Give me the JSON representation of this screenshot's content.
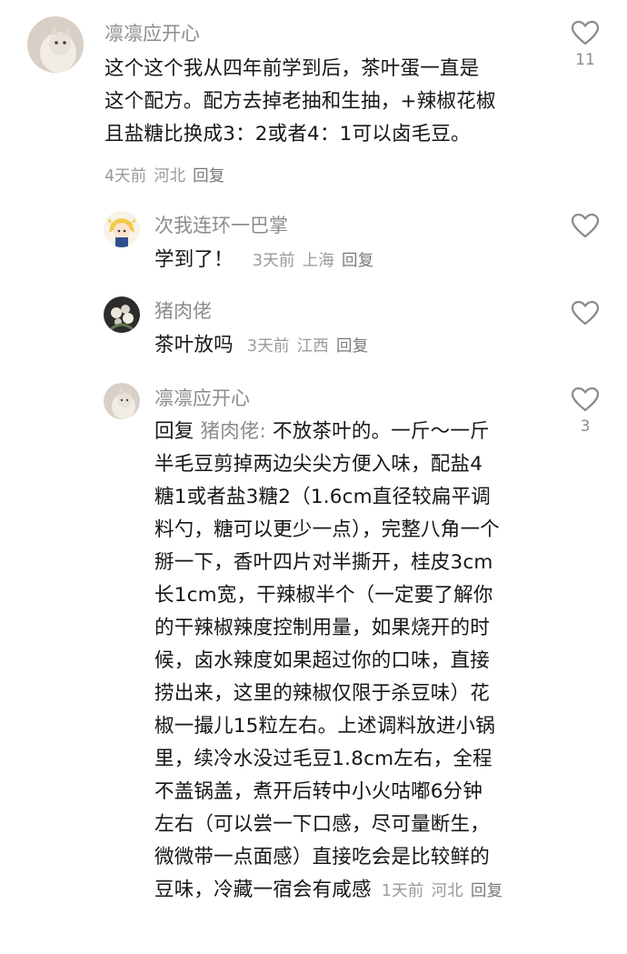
{
  "comments": [
    {
      "username": "凛凛应开心",
      "text_lines": [
        "这个这个我从四年前学到后，茶叶蛋一直是",
        "这个配方。配方去掉老抽和生抽，+辣椒花椒",
        "且盐糖比换成3：2或者4：1可以卤毛豆。"
      ],
      "time": "4天前",
      "location": "河北",
      "reply_label": "回复",
      "like_count": "11",
      "avatar_icon": "cat-photo-avatar"
    },
    {
      "username": "次我连环一巴掌",
      "text": "学到了！",
      "time": "3天前",
      "location": "上海",
      "reply_label": "回复",
      "like_count": "",
      "avatar_icon": "cartoon-girl-avatar"
    },
    {
      "username": "猪肉佬",
      "text": "茶叶放吗",
      "time": "3天前",
      "location": "江西",
      "reply_label": "回复",
      "like_count": "",
      "avatar_icon": "flower-photo-avatar"
    },
    {
      "username": "凛凛应开心",
      "reply_prefix": "回复",
      "reply_target": "猪肉佬:",
      "text_lines": [
        " 不放茶叶的。一斤～一斤",
        "半毛豆剪掉两边尖尖方便入味，配盐4",
        "糖1或者盐3糖2（1.6cm直径较扁平调",
        "料勺，糖可以更少一点），完整八角一个",
        "掰一下，香叶四片对半撕开，桂皮3cm",
        "长1cm宽，干辣椒半个（一定要了解你",
        "的干辣椒辣度控制用量，如果烧开的时",
        "候，卤水辣度如果超过你的口味，直接",
        "捞出来，这里的辣椒仅限于杀豆味）花",
        "椒一撮儿15粒左右。上述调料放进小锅",
        "里，续冷水没过毛豆1.8cm左右，全程",
        "不盖锅盖，煮开后转中小火咕嘟6分钟",
        "左右（可以尝一下口感，尽可量断生，",
        "微微带一点面感）直接吃会是比较鲜的",
        "豆味，冷藏一宿会有咸感"
      ],
      "time": "1天前",
      "location": "河北",
      "reply_label": "回复",
      "like_count": "3",
      "avatar_icon": "cat-photo-avatar"
    }
  ],
  "colors": {
    "text": "#161616",
    "muted": "#8c8c8c",
    "icon": "#8a8a8a"
  }
}
